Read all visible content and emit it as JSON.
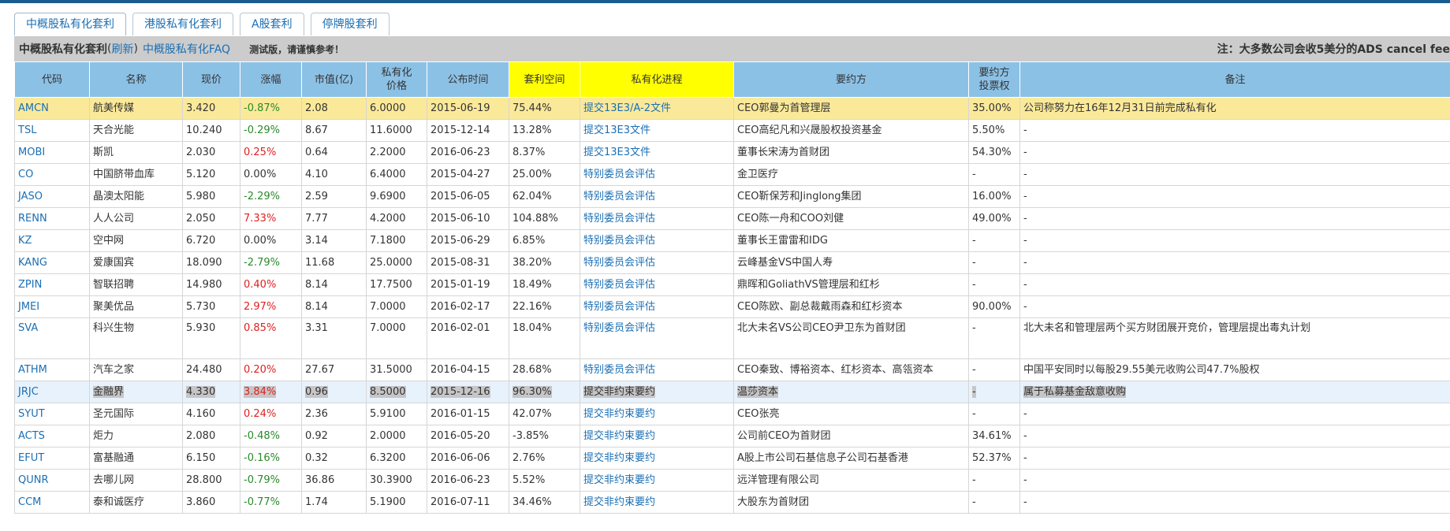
{
  "tabs": [
    {
      "label": "中概股私有化套利"
    },
    {
      "label": "港股私有化套利"
    },
    {
      "label": "A股套利"
    },
    {
      "label": "停牌股套利"
    }
  ],
  "header": {
    "title": "中概股私有化套利",
    "paren_open": "(",
    "refresh": "刷新",
    "paren_close": ")",
    "faq": "中概股私有化FAQ",
    "beta": "测试版，请谨慎参考！",
    "note": "注：大多数公司会收5美分的ADS cancel fee"
  },
  "columns": {
    "code": "代码",
    "name": "名称",
    "price": "现价",
    "change": "涨幅",
    "cap": "市值(亿)",
    "priv_price_1": "私有化",
    "priv_price_2": "价格",
    "date": "公布时间",
    "spread": "套利空间",
    "progress": "私有化进程",
    "offeror": "要约方",
    "vote_1": "要约方",
    "vote_2": "投票权",
    "remark": "备注"
  },
  "rows": [
    {
      "code": "AMCN",
      "name": "航美传媒",
      "price": "3.420",
      "change": "-0.87%",
      "dir": "down",
      "cap": "2.08",
      "priv": "6.0000",
      "date": "2015-06-19",
      "spread": "75.44%",
      "progress": "提交13E3/A-2文件",
      "offeror": "CEO郭曼为首管理层",
      "vote": "35.00%",
      "remark": "公司称努力在16年12月31日前完成私有化"
    },
    {
      "code": "TSL",
      "name": "天合光能",
      "price": "10.240",
      "change": "-0.29%",
      "dir": "down",
      "cap": "8.67",
      "priv": "11.6000",
      "date": "2015-12-14",
      "spread": "13.28%",
      "progress": "提交13E3文件",
      "offeror": "CEO高纪凡和兴晟股权投资基金",
      "vote": "5.50%",
      "remark": "-"
    },
    {
      "code": "MOBI",
      "name": "斯凯",
      "price": "2.030",
      "change": "0.25%",
      "dir": "up",
      "cap": "0.64",
      "priv": "2.2000",
      "date": "2016-06-23",
      "spread": "8.37%",
      "progress": "提交13E3文件",
      "offeror": "董事长宋涛为首财团",
      "vote": "54.30%",
      "remark": "-"
    },
    {
      "code": "CO",
      "name": "中国脐带血库",
      "price": "5.120",
      "change": "0.00%",
      "dir": "flat",
      "cap": "4.10",
      "priv": "6.4000",
      "date": "2015-04-27",
      "spread": "25.00%",
      "progress": "特别委员会评估",
      "offeror": "金卫医疗",
      "vote": "-",
      "remark": "-"
    },
    {
      "code": "JASO",
      "name": "晶澳太阳能",
      "price": "5.980",
      "change": "-2.29%",
      "dir": "down",
      "cap": "2.59",
      "priv": "9.6900",
      "date": "2015-06-05",
      "spread": "62.04%",
      "progress": "特别委员会评估",
      "offeror": "CEO靳保芳和Jinglong集团",
      "vote": "16.00%",
      "remark": "-"
    },
    {
      "code": "RENN",
      "name": "人人公司",
      "price": "2.050",
      "change": "7.33%",
      "dir": "up",
      "cap": "7.77",
      "priv": "4.2000",
      "date": "2015-06-10",
      "spread": "104.88%",
      "progress": "特别委员会评估",
      "offeror": "CEO陈一舟和COO刘健",
      "vote": "49.00%",
      "remark": "-"
    },
    {
      "code": "KZ",
      "name": "空中网",
      "price": "6.720",
      "change": "0.00%",
      "dir": "flat",
      "cap": "3.14",
      "priv": "7.1800",
      "date": "2015-06-29",
      "spread": "6.85%",
      "progress": "特别委员会评估",
      "offeror": "董事长王雷雷和IDG",
      "vote": "-",
      "remark": "-"
    },
    {
      "code": "KANG",
      "name": "爱康国宾",
      "price": "18.090",
      "change": "-2.79%",
      "dir": "down",
      "cap": "11.68",
      "priv": "25.0000",
      "date": "2015-08-31",
      "spread": "38.20%",
      "progress": "特别委员会评估",
      "offeror": "云峰基金VS中国人寿",
      "vote": "-",
      "remark": "-"
    },
    {
      "code": "ZPIN",
      "name": "智联招聘",
      "price": "14.980",
      "change": "0.40%",
      "dir": "up",
      "cap": "8.14",
      "priv": "17.7500",
      "date": "2015-01-19",
      "spread": "18.49%",
      "progress": "特别委员会评估",
      "offeror": "鼎晖和GoliathVS管理层和红杉",
      "vote": "-",
      "remark": "-"
    },
    {
      "code": "JMEI",
      "name": "聚美优品",
      "price": "5.730",
      "change": "2.97%",
      "dir": "up",
      "cap": "8.14",
      "priv": "7.0000",
      "date": "2016-02-17",
      "spread": "22.16%",
      "progress": "特别委员会评估",
      "offeror": "CEO陈欧、副总裁戴雨森和红杉资本",
      "vote": "90.00%",
      "remark": "-"
    },
    {
      "code": "SVA",
      "name": "科兴生物",
      "price": "5.930",
      "change": "0.85%",
      "dir": "up",
      "cap": "3.31",
      "priv": "7.0000",
      "date": "2016-02-01",
      "spread": "18.04%",
      "progress": "特别委员会评估",
      "offeror": "北大未名VS公司CEO尹卫东为首财团",
      "vote": "-",
      "remark": "北大未名和管理层两个买方财团展开竞价，管理层提出毒丸计划",
      "tall": true
    },
    {
      "code": "ATHM",
      "name": "汽车之家",
      "price": "24.480",
      "change": "0.20%",
      "dir": "up",
      "cap": "27.67",
      "priv": "31.5000",
      "date": "2016-04-15",
      "spread": "28.68%",
      "progress": "特别委员会评估",
      "offeror": "CEO秦致、博裕资本、红杉资本、高瓴资本",
      "vote": "-",
      "remark": "中国平安同时以每股29.55美元收购公司47.7%股权"
    },
    {
      "code": "JRJC",
      "name": "金融界",
      "price": "4.330",
      "change": "3.84%",
      "dir": "up",
      "cap": "0.96",
      "priv": "8.5000",
      "date": "2015-12-16",
      "spread": "96.30%",
      "progress": "提交非约束要约",
      "offeror": "温莎资本",
      "vote": "-",
      "remark": "属于私募基金敌意收购",
      "selected": true
    },
    {
      "code": "SYUT",
      "name": "圣元国际",
      "price": "4.160",
      "change": "0.24%",
      "dir": "up",
      "cap": "2.36",
      "priv": "5.9100",
      "date": "2016-01-15",
      "spread": "42.07%",
      "progress": "提交非约束要约",
      "offeror": "CEO张亮",
      "vote": "-",
      "remark": "-"
    },
    {
      "code": "ACTS",
      "name": "炬力",
      "price": "2.080",
      "change": "-0.48%",
      "dir": "down",
      "cap": "0.92",
      "priv": "2.0000",
      "date": "2016-05-20",
      "spread": "-3.85%",
      "progress": "提交非约束要约",
      "offeror": "公司前CEO为首财团",
      "vote": "34.61%",
      "remark": "-"
    },
    {
      "code": "EFUT",
      "name": "富基融通",
      "price": "6.150",
      "change": "-0.16%",
      "dir": "down",
      "cap": "0.32",
      "priv": "6.3200",
      "date": "2016-06-06",
      "spread": "2.76%",
      "progress": "提交非约束要约",
      "offeror": "A股上市公司石基信息子公司石基香港",
      "vote": "52.37%",
      "remark": "-"
    },
    {
      "code": "QUNR",
      "name": "去哪儿网",
      "price": "28.800",
      "change": "-0.79%",
      "dir": "down",
      "cap": "36.86",
      "priv": "30.3900",
      "date": "2016-06-23",
      "spread": "5.52%",
      "progress": "提交非约束要约",
      "offeror": "远洋管理有限公司",
      "vote": "-",
      "remark": "-"
    },
    {
      "code": "CCM",
      "name": "泰和诚医疗",
      "price": "3.860",
      "change": "-0.77%",
      "dir": "down",
      "cap": "1.74",
      "priv": "5.1900",
      "date": "2016-07-11",
      "spread": "34.46%",
      "progress": "提交非约束要约",
      "offeror": "大股东为首财团",
      "vote": "-",
      "remark": "-"
    }
  ]
}
